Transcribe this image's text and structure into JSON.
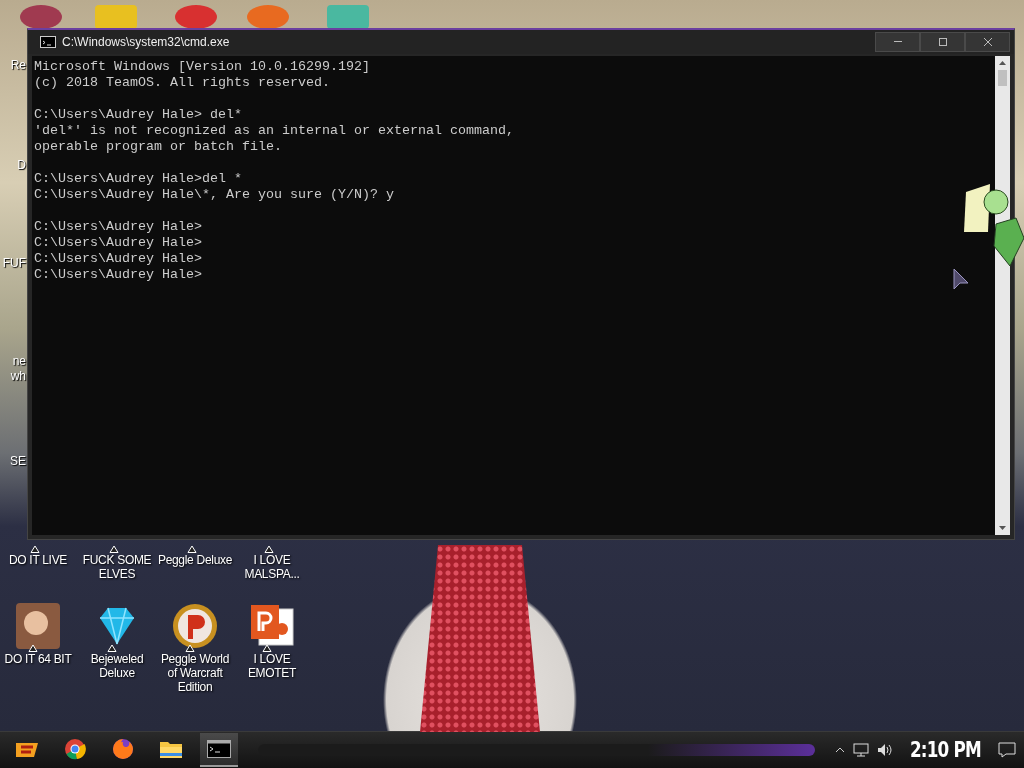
{
  "window": {
    "title": "C:\\Windows\\system32\\cmd.exe"
  },
  "console": {
    "blocks": [
      {
        "lines": [
          "Microsoft Windows [Version 10.0.16299.192]",
          "(c) 2018 TeamOS. All rights reserved."
        ]
      },
      {
        "lines": [
          "C:\\Users\\Audrey Hale> del*",
          "'del*' is not recognized as an internal or external command,",
          "operable program or batch file."
        ]
      },
      {
        "lines": [
          "C:\\Users\\Audrey Hale>del *",
          "C:\\Users\\Audrey Hale\\*, Are you sure (Y/N)? y"
        ]
      },
      {
        "lines": [
          "C:\\Users\\Audrey Hale>",
          "C:\\Users\\Audrey Hale>",
          "C:\\Users\\Audrey Hale>",
          "C:\\Users\\Audrey Hale>"
        ]
      }
    ]
  },
  "edge_labels": [
    {
      "lines": [
        "Re"
      ]
    },
    {
      "lines": [
        "D"
      ]
    },
    {
      "lines": [
        "FUF"
      ]
    },
    {
      "lines": [
        "ne",
        "wh"
      ]
    },
    {
      "lines": [
        "SE"
      ]
    }
  ],
  "desktop_icons": [
    {
      "label": "DO IT LIVE",
      "kind": "covered"
    },
    {
      "label": "FUCK SOME ELVES",
      "kind": "covered"
    },
    {
      "label": "Peggle Deluxe",
      "kind": "covered"
    },
    {
      "label": "I LOVE MALSPA...",
      "kind": "covered"
    },
    {
      "label": "DO IT 64 BIT",
      "kind": "portrait"
    },
    {
      "label": "Bejeweled Deluxe",
      "kind": "gem"
    },
    {
      "label": "Peggle World of Warcraft Edition",
      "kind": "peggle"
    },
    {
      "label": "I LOVE EMOTET",
      "kind": "slides"
    }
  ],
  "taskbar": {
    "apps": [
      {
        "kind": "start",
        "selected": false
      },
      {
        "kind": "chrome",
        "selected": false
      },
      {
        "kind": "firefox",
        "selected": false
      },
      {
        "kind": "folder",
        "selected": false
      },
      {
        "kind": "console",
        "selected": true
      }
    ],
    "clock": "2:10 PM"
  }
}
